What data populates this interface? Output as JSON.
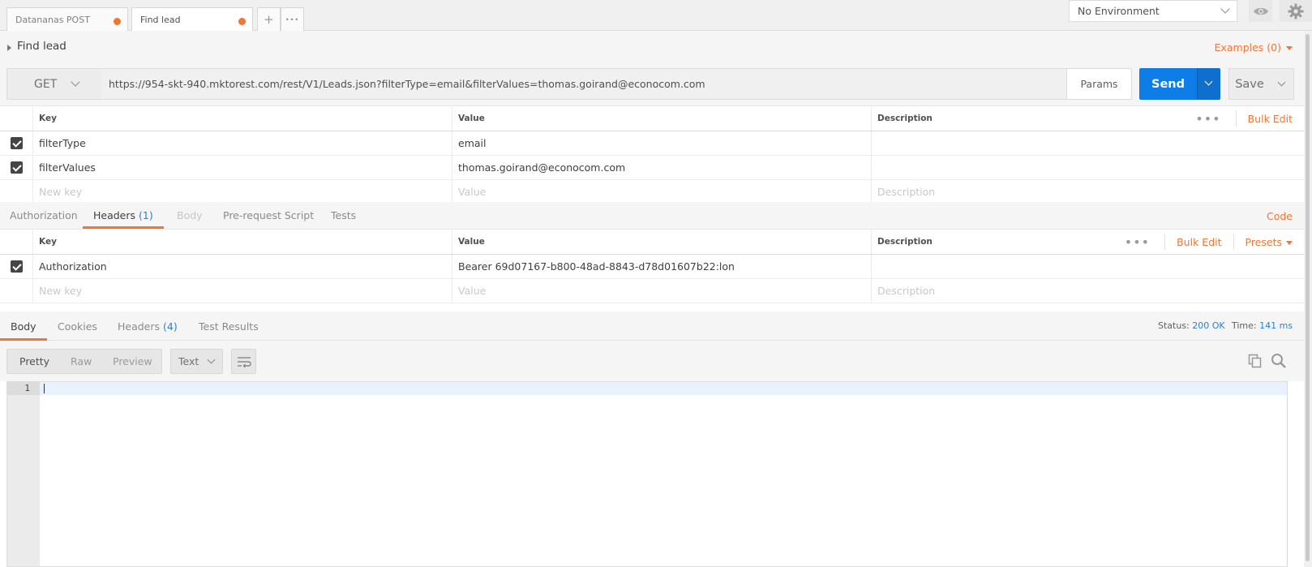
{
  "tabs": [
    {
      "label": "Datananas POST",
      "active": false,
      "unsaved": true
    },
    {
      "label": "Find lead",
      "active": true,
      "unsaved": true
    }
  ],
  "tab_actions": {
    "add": "+",
    "more": "•••"
  },
  "environment": {
    "selected": "No Environment"
  },
  "request": {
    "name": "Find lead",
    "examples_label": "Examples (0)",
    "method": "GET",
    "url": "https://954-skt-940.mktorest.com/rest/V1/Leads.json?filterType=email&filterValues=thomas.goirand@econocom.com",
    "params_label": "Params",
    "send_label": "Send",
    "save_label": "Save"
  },
  "params_table": {
    "headers": {
      "key": "Key",
      "value": "Value",
      "description": "Description"
    },
    "bulk_edit": "Bulk Edit",
    "rows": [
      {
        "key": "filterType",
        "value": "email",
        "description": ""
      },
      {
        "key": "filterValues",
        "value": "thomas.goirand@econocom.com",
        "description": ""
      }
    ],
    "new_row": {
      "key": "New key",
      "value": "Value",
      "description": "Description"
    }
  },
  "request_tabs": [
    {
      "label": "Authorization",
      "count": "",
      "state": "normal"
    },
    {
      "label": "Headers",
      "count": "(1)",
      "state": "active"
    },
    {
      "label": "Body",
      "count": "",
      "state": "disabled"
    },
    {
      "label": "Pre-request Script",
      "count": "",
      "state": "normal"
    },
    {
      "label": "Tests",
      "count": "",
      "state": "normal"
    }
  ],
  "code_label": "Code",
  "headers_table": {
    "headers": {
      "key": "Key",
      "value": "Value",
      "description": "Description"
    },
    "bulk_edit": "Bulk Edit",
    "presets": "Presets",
    "rows": [
      {
        "key": "Authorization",
        "value": "Bearer 69d07167-b800-48ad-8843-d78d01607b22:lon",
        "description": ""
      }
    ],
    "new_row": {
      "key": "New key",
      "value": "Value",
      "description": "Description"
    }
  },
  "response_tabs": [
    {
      "label": "Body",
      "count": "",
      "state": "active"
    },
    {
      "label": "Cookies",
      "count": "",
      "state": "normal"
    },
    {
      "label": "Headers",
      "count": "(4)",
      "state": "normal"
    },
    {
      "label": "Test Results",
      "count": "",
      "state": "normal"
    }
  ],
  "response_status": {
    "status_label": "Status:",
    "status_value": "200 OK",
    "time_label": "Time:",
    "time_value": "141 ms"
  },
  "response_view": {
    "modes": [
      "Pretty",
      "Raw",
      "Preview"
    ],
    "active_mode": "Pretty",
    "format": "Text"
  },
  "editor": {
    "line_numbers": [
      "1"
    ]
  },
  "colors": {
    "accent": "#f07633",
    "send": "#0f7de8",
    "link": "#2c7fd4"
  }
}
